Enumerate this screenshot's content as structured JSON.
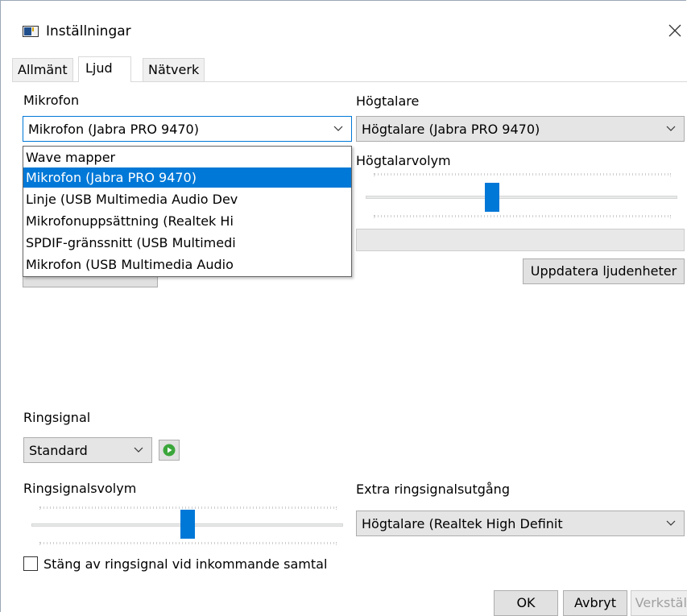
{
  "window": {
    "title": "Inställningar"
  },
  "tabs": [
    {
      "label": "Allmänt",
      "active": false
    },
    {
      "label": "Ljud",
      "active": true
    },
    {
      "label": "Nätverk",
      "active": false
    }
  ],
  "microphone": {
    "label": "Mikrofon",
    "selected": "Mikrofon (Jabra PRO 9470)",
    "options": [
      "Wave mapper",
      "Mikrofon (Jabra PRO 9470)",
      "Linje (USB Multimedia Audio Dev",
      "Mikrofonuppsättning (Realtek Hi",
      "SPDIF-gränssnitt (USB Multimedi",
      "Mikrofon (USB Multimedia Audio"
    ],
    "highlighted_index": 1
  },
  "speakers": {
    "label": "Högtalare",
    "selected": "Högtalare (Jabra PRO 9470)",
    "volume_label": "Högtalarvolym",
    "volume_fraction": 0.4
  },
  "refresh_button": "Uppdatera ljudenheter",
  "ringtone": {
    "label": "Ringsignal",
    "selected": "Standard",
    "volume_label": "Ringsignalsvolym",
    "volume_fraction": 0.5,
    "extra_output_label": "Extra ringsignalsutgång",
    "extra_output_selected": "Högtalare (Realtek High Definit",
    "mute_checkbox_label": "Stäng av ringsignal vid inkommande samtal",
    "mute_checked": false
  },
  "footer": {
    "ok": "OK",
    "cancel": "Avbryt",
    "apply": "Verkställ"
  },
  "colors": {
    "accent": "#0078d7",
    "play_green": "#3aa63a"
  }
}
